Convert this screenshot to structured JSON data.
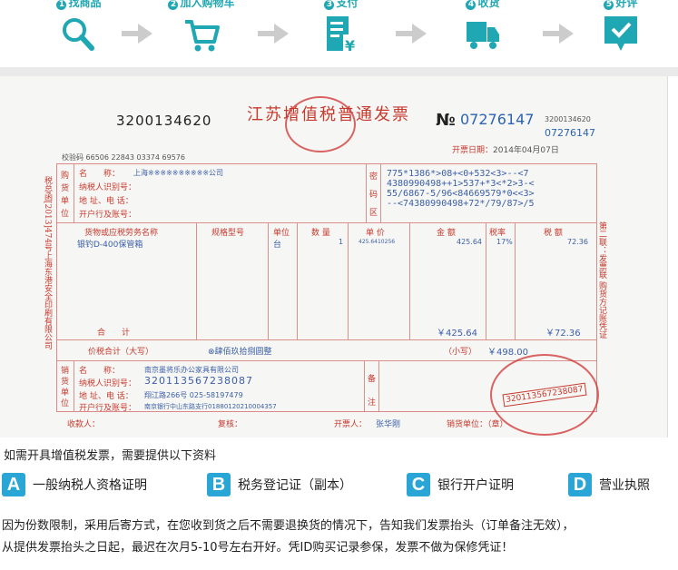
{
  "steps": [
    {
      "num": "1",
      "label": "找商品",
      "icon": "search-icon"
    },
    {
      "num": "2",
      "label": "加入购物车",
      "icon": "cart-icon"
    },
    {
      "num": "3",
      "label": "支付",
      "icon": "invoice-pay-icon"
    },
    {
      "num": "4",
      "label": "收货",
      "icon": "truck-icon"
    },
    {
      "num": "5",
      "label": "好评",
      "icon": "check-icon"
    }
  ],
  "colors": {
    "accent": "#1fa7b3",
    "badge": "#29a5d6",
    "invoice_red": "#c73a2e",
    "invoice_blue": "#3b5fa8"
  },
  "invoice": {
    "title": "江苏增值税普通发票",
    "code": "3200134620",
    "no_label": "№",
    "no": "07276147",
    "small_code": "3200134620",
    "small_no": "07276147",
    "date_label": "开票日期：",
    "date_value": "2014年04月07日",
    "check_code": "校验码 66506 22843 03374 69576",
    "buyer_header": [
      "购",
      "货",
      "单",
      "位"
    ],
    "buyer_labels": [
      "名　　称：",
      "纳税人识别号：",
      "地 址、电 话：",
      "开户行及账号："
    ],
    "buyer_name": "上海※※※※※※※※※※公司",
    "cipher_label": [
      "密",
      "码",
      "区"
    ],
    "cipher": "775*1386*>08+<0+532<3>--<7\n4380990498++1>537+*3<*2>3-<\n55/6867-5/96<84669579*0<<3>\n--<74380990498+72*/79/87>/5",
    "col_headers": [
      "货物或应税劳务名称",
      "规格型号",
      "单位",
      "数 量",
      "单 价",
      "金 额",
      "税率",
      "税 额"
    ],
    "item": {
      "name": "银钓D-400保管箱",
      "unit": "台",
      "qty": "1",
      "price": "425.6410256",
      "amount": "425.64",
      "rate": "17%",
      "tax": "72.36"
    },
    "total_label": "合　　计",
    "total_amount": "￥425.64",
    "total_tax": "￥72.36",
    "sum_label": "价税合计（大写）",
    "sum_text": "⊗肆佰玖拾捌圆整",
    "small_label": "（小写）",
    "small_value": "￥498.00",
    "seller_header": [
      "销",
      "货",
      "单",
      "位"
    ],
    "seller_labels": [
      "名　　称：",
      "纳税人识别号：",
      "地 址、电 话：",
      "开户行及账号："
    ],
    "seller_name": "南京墨将乐办公家具有限公司",
    "seller_tax_id": "320113567238087",
    "seller_addr": "翔江路266号  025-58197479",
    "seller_bank": "南京银行中山东路支行01880120210004357",
    "remark_label": [
      "备",
      "注"
    ],
    "footer": {
      "payee": "收款人：",
      "review": "复核：",
      "issuer": "开票人：",
      "issuer_name": "张华刚",
      "seller": "销货单位：（章）"
    },
    "side_left": "税总函[2013]474号上海东港安全印刷有限公司",
    "side_right": "第二联：发票联 购货方记账凭证",
    "stamp_text": "320113567238087"
  },
  "notes": {
    "title": "如需开具增值税发票，需要提供以下资料",
    "docs": [
      {
        "badge": "A",
        "label": "一般纳税人资格证明"
      },
      {
        "badge": "B",
        "label": "税务登记证（副本）"
      },
      {
        "badge": "C",
        "label": "银行开户证明"
      },
      {
        "badge": "D",
        "label": "营业执照"
      }
    ],
    "line1": "因为份数限制，采用后寄方式，在您收到货之后不需要退换货的情况下，告知我们发票抬头（订单备注无效），",
    "line2": "从提供发票抬头之日起，最迟在次月5-10号左右开好。凭ID购买记录参保，发票不做为保修凭证！"
  }
}
